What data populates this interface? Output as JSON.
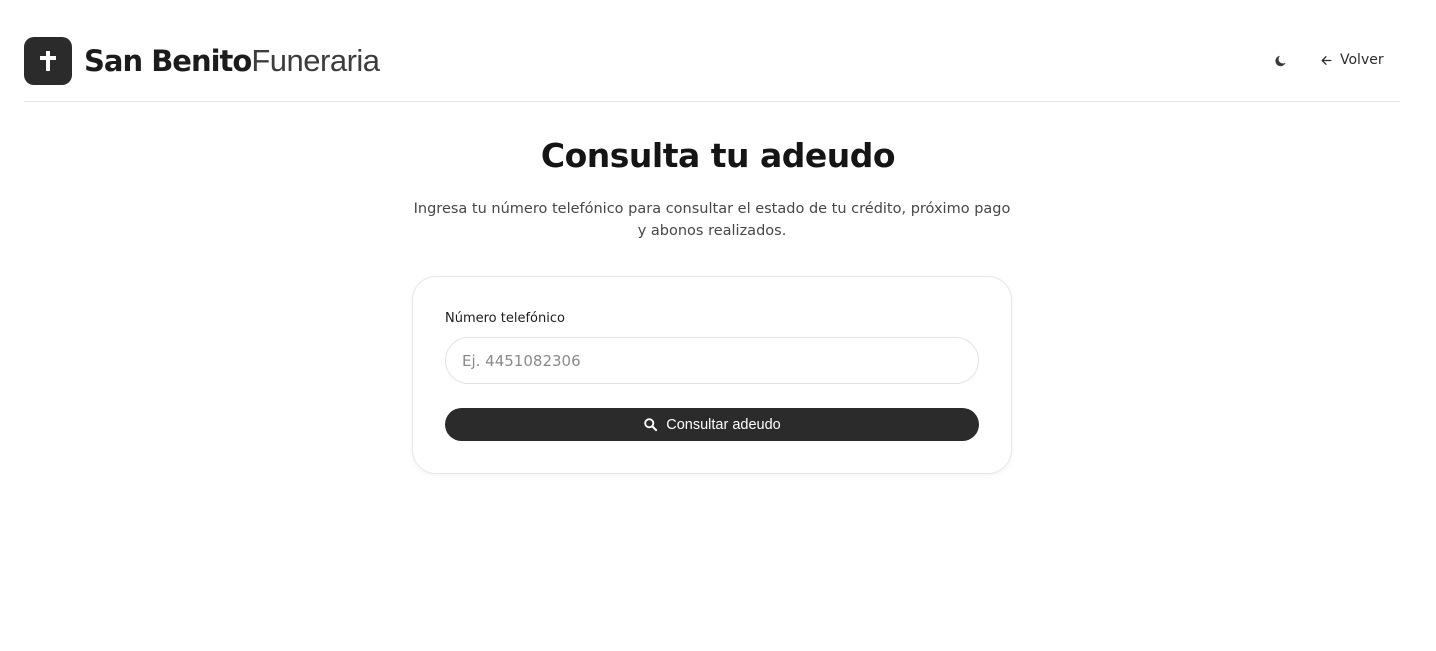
{
  "header": {
    "brand_strong": "San Benito",
    "brand_light": "Funeraria",
    "logo_icon": "cross-icon",
    "theme_icon": "moon-icon",
    "back_icon": "arrow-left-icon",
    "back_label": "Volver"
  },
  "main": {
    "title": "Consulta tu adeudo",
    "description": "Ingresa tu número telefónico para consultar el estado de tu crédito, próximo pago y abonos realizados."
  },
  "form": {
    "phone_label": "Número telefónico",
    "phone_value": "",
    "phone_placeholder": "Ej. 4451082306",
    "submit_icon": "search-icon",
    "submit_label": "Consultar adeudo"
  },
  "colors": {
    "brand_dark": "#2b2b2b",
    "border": "#e4e4e4",
    "background": "#ffffff"
  }
}
